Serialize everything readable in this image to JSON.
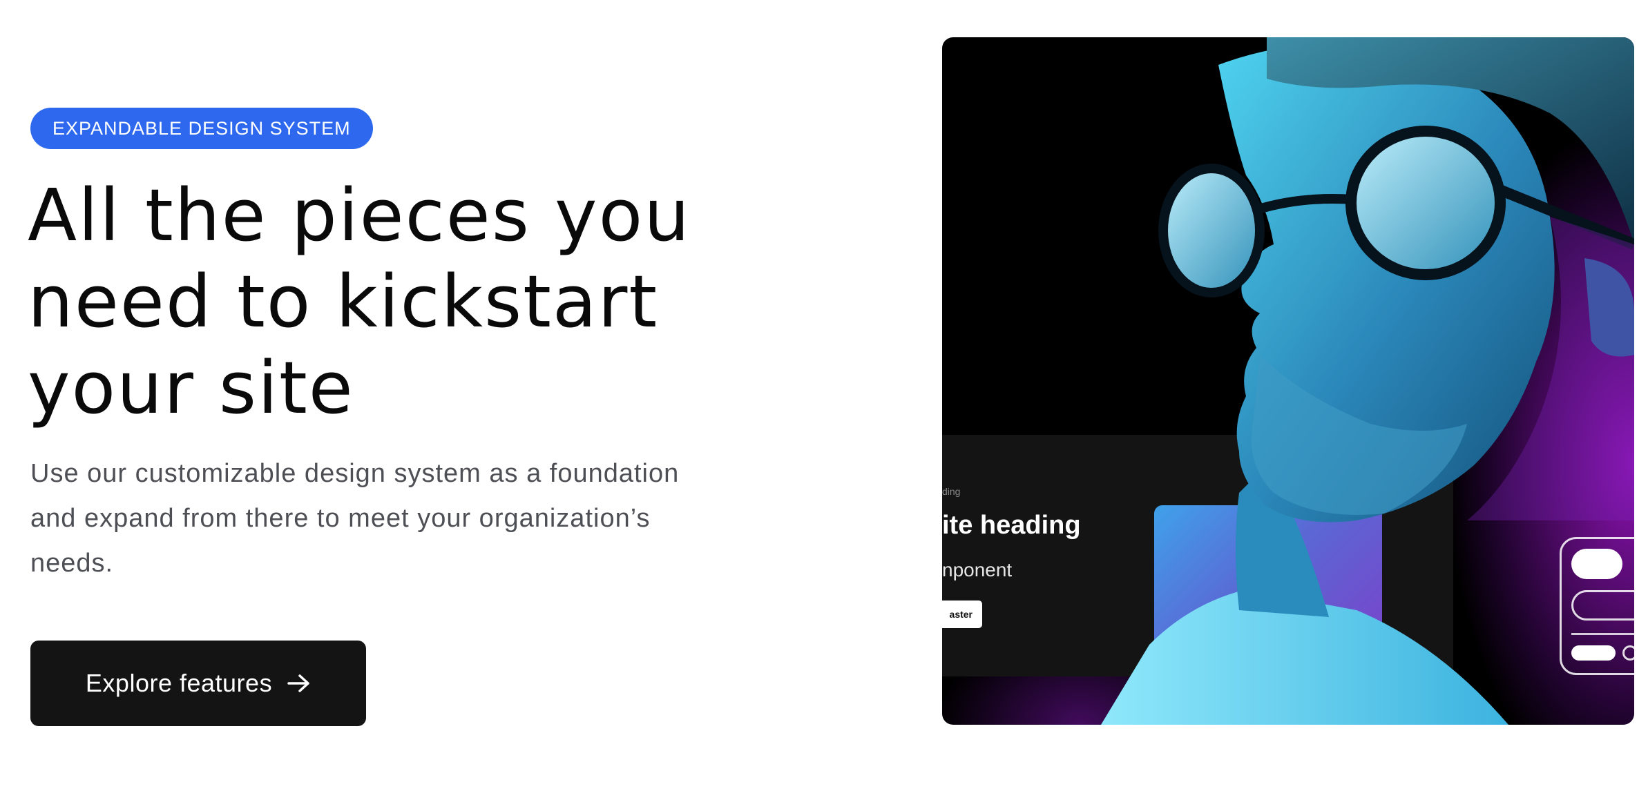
{
  "hero": {
    "badge": "EXPANDABLE DESIGN SYSTEM",
    "headline": "All the pieces you need to kickstart your site",
    "description": "Use our customizable design system as a foundation and expand from there to meet your organization’s needs.",
    "cta_label": "Explore features",
    "cta_icon": "arrow-right-icon"
  },
  "image": {
    "ui_eyebrow": "ding",
    "ui_heading": "ite heading",
    "ui_subheading": "nponent",
    "ui_button": "aster"
  },
  "colors": {
    "badge_bg": "#2d68ef",
    "cta_bg": "#141414",
    "headline": "#0a0a0a",
    "body_text": "#4d4f55"
  }
}
